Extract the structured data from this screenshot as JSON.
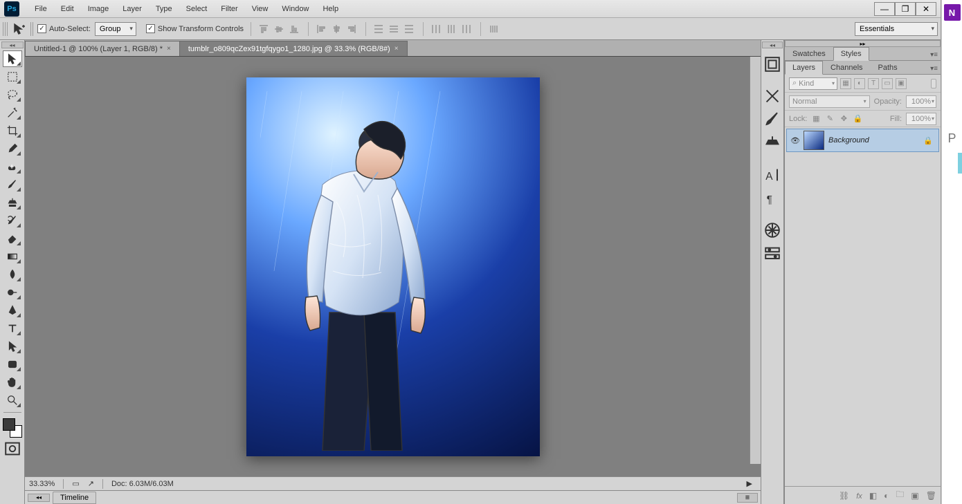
{
  "menubar": {
    "logo": "Ps",
    "items": [
      "File",
      "Edit",
      "Image",
      "Layer",
      "Type",
      "Select",
      "Filter",
      "View",
      "Window",
      "Help"
    ]
  },
  "optionsbar": {
    "auto_select_label": "Auto-Select:",
    "auto_select_mode": "Group",
    "show_transform_label": "Show Transform Controls",
    "workspace": "Essentials"
  },
  "doc_tabs": [
    {
      "label": "Untitled-1 @ 100% (Layer 1, RGB/8) *",
      "active": false
    },
    {
      "label": "tumblr_o809qcZex91tgfqygo1_1280.jpg @ 33.3% (RGB/8#)",
      "active": true
    }
  ],
  "status": {
    "zoom": "33.33%",
    "doc": "Doc: 6.03M/6.03M"
  },
  "timeline": {
    "label": "Timeline"
  },
  "swatches_panel": {
    "tabs": [
      "Swatches",
      "Styles"
    ],
    "active": 1
  },
  "layers_panel": {
    "tabs": [
      "Layers",
      "Channels",
      "Paths"
    ],
    "active": 0,
    "filter_kind": "Kind",
    "blend_mode": "Normal",
    "opacity_label": "Opacity:",
    "opacity_value": "100%",
    "lock_label": "Lock:",
    "fill_label": "Fill:",
    "fill_value": "100%",
    "layers": [
      {
        "name": "Background",
        "locked": true
      }
    ]
  },
  "onenote_letter": "P"
}
